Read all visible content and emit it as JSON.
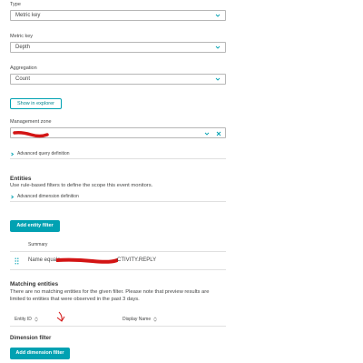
{
  "type_field": {
    "label": "Type",
    "value": "Metric key"
  },
  "metric_key_field": {
    "label": "Metric key",
    "value": "Depth"
  },
  "aggregation_field": {
    "label": "Aggregation",
    "value": "Count"
  },
  "show_in_explorer": "Show in explorer",
  "management_zone": {
    "label": "Management zone",
    "value": ""
  },
  "advanced_query": "Advanced query definition",
  "entities": {
    "title": "Entities",
    "description": "Use rule-based filters to define the scope this event monitors.",
    "advanced_dimension": "Advanced dimension definition",
    "add_filter": "Add entity filter",
    "summary_header": "Summary",
    "filter_row_prefix": "Name equals",
    "filter_row_suffix": "CTIVITY.REPLY"
  },
  "matching": {
    "title": "Matching entities",
    "message_line1": "There are no matching entities for the given filter. Please note that preview results are",
    "message_line2": "limited to entities that were observed in the past 3 days.",
    "col_entity_id": "Entity ID",
    "col_display_name": "Display Name"
  },
  "dimension_filter": {
    "title": "Dimension filter",
    "add_button": "Add dimension filter"
  },
  "colors": {
    "accent": "#00a1b2",
    "redaction": "#d31515",
    "text": "#454646"
  },
  "icons": {
    "chevron": "chevron-down-icon",
    "clear": "close-icon",
    "expand": "chevron-right-icon",
    "drag": "drag-handle-icon",
    "sort": "sort-icon"
  }
}
